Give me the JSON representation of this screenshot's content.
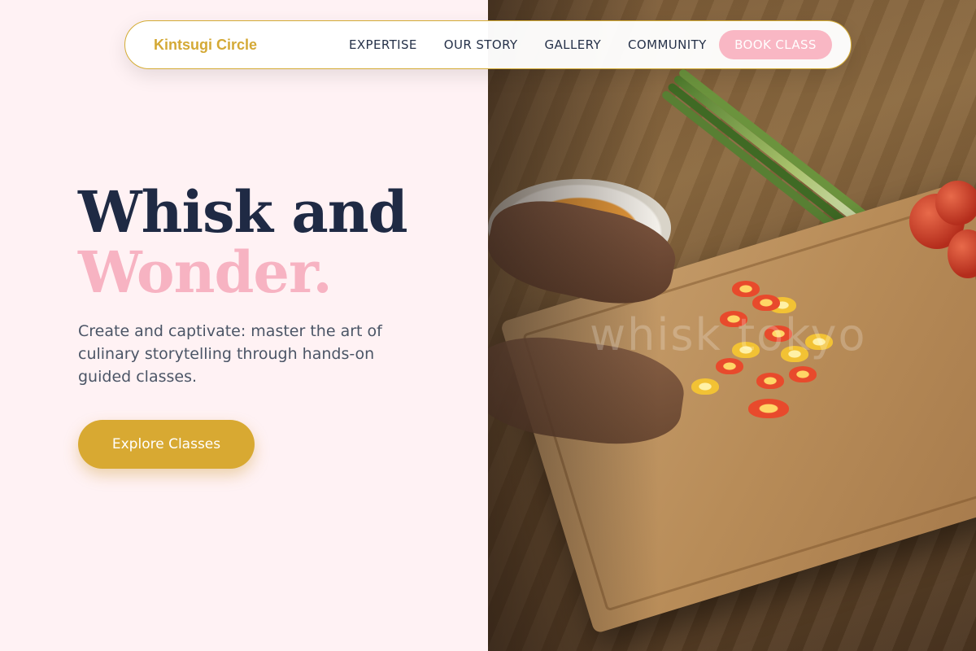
{
  "brand": {
    "name": "Kintsugi Circle"
  },
  "nav": {
    "links": [
      "EXPERTISE",
      "OUR STORY",
      "GALLERY",
      "COMMUNITY"
    ],
    "cta_label": "BOOK CLASS"
  },
  "hero": {
    "title_line1": "Whisk and",
    "title_line2": "Wonder.",
    "description": "Create and captivate: master the art of culinary storytelling through hands-on guided classes.",
    "cta_label": "Explore Classes"
  },
  "image": {
    "watermark": "whisk tokyo"
  },
  "colors": {
    "accent_gold": "#d8a932",
    "accent_pink": "#f7b3c2",
    "navy": "#1f2a44",
    "background": "#fff2f4"
  }
}
